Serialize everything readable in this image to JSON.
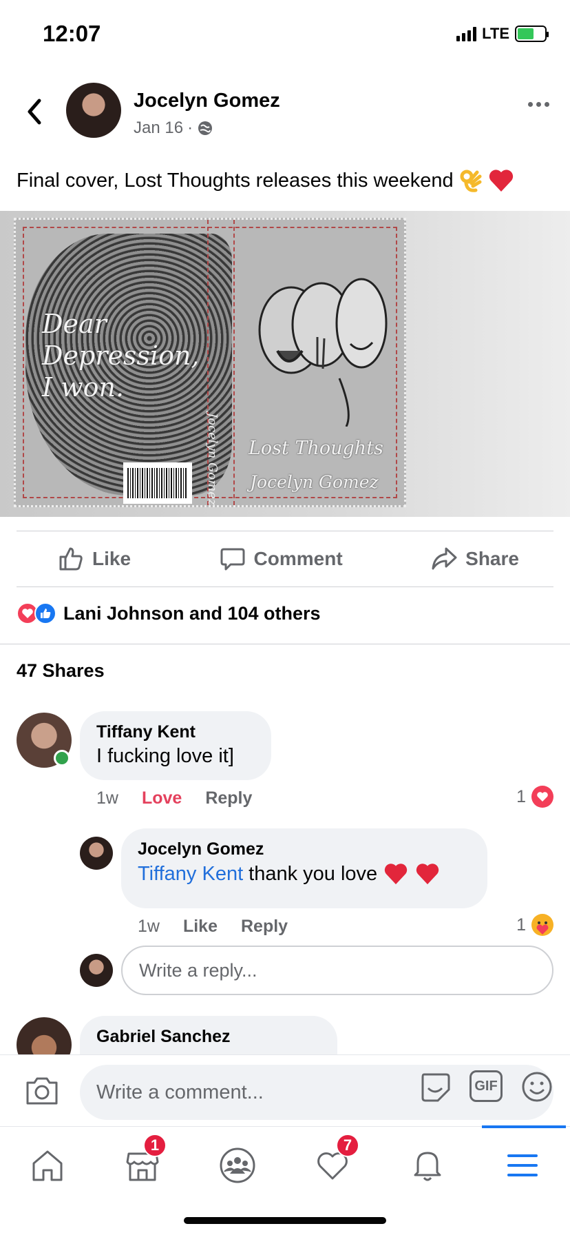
{
  "status": {
    "time": "12:07",
    "network": "LTE"
  },
  "post": {
    "author": "Jocelyn Gomez",
    "date": "Jan 16",
    "separator": "·",
    "text": "Final cover, Lost Thoughts releases this weekend",
    "image": {
      "back_cover_line1": "Dear",
      "back_cover_line2": "Depression,",
      "back_cover_line3": "I won.",
      "title": "Lost Thoughts",
      "author": "Jocelyn Gomez",
      "spine": "Jocelyn Gomez"
    }
  },
  "actions": {
    "like": "Like",
    "comment": "Comment",
    "share": "Share"
  },
  "reactions_summary": "Lani Johnson and 104 others",
  "shares": "47 Shares",
  "comments": [
    {
      "author": "Tiffany Kent",
      "text": "I fucking love it]",
      "time": "1w",
      "reaction_label": "Love",
      "reply_label": "Reply",
      "reaction_count": "1",
      "reaction_type": "love",
      "replies": [
        {
          "author": "Jocelyn Gomez",
          "mention": "Tiffany Kent",
          "text": "thank you love",
          "time": "1w",
          "like_label": "Like",
          "reply_label": "Reply",
          "reaction_count": "1",
          "reaction_type": "care"
        }
      ]
    },
    {
      "author": "Gabriel Sanchez"
    }
  ],
  "reply_placeholder": "Write a reply...",
  "composer": {
    "placeholder": "Write a comment...",
    "gif_label": "GIF"
  },
  "tabbar": {
    "items": [
      "home",
      "marketplace",
      "groups",
      "dating",
      "notifications",
      "menu"
    ],
    "marketplace_badge": "1",
    "dating_badge": "7",
    "active": "menu"
  },
  "colors": {
    "accent": "#1877f2",
    "love": "#f33e58",
    "online": "#31a24c",
    "badge": "#e41e3f"
  }
}
